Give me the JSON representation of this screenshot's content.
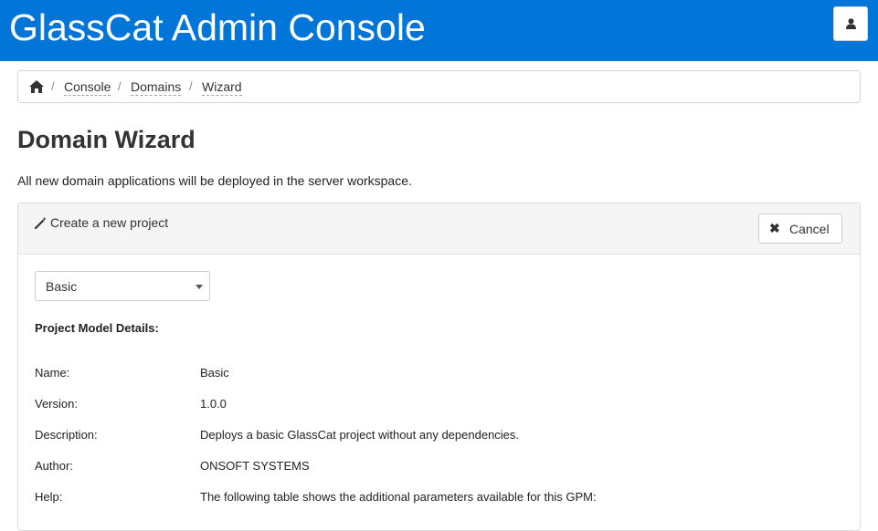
{
  "header": {
    "title": "GlassCat Admin Console",
    "user_icon": "user-icon"
  },
  "breadcrumb": {
    "home_icon": "home-icon",
    "separator": "/",
    "items": [
      "Console",
      "Domains",
      "Wizard"
    ]
  },
  "page": {
    "title": "Domain Wizard",
    "intro": "All new domain applications will be deployed in the server workspace."
  },
  "panel": {
    "title": "Create a new project",
    "title_icon": "magic-wand-icon",
    "cancel_label": "Cancel",
    "cancel_icon": "close-icon",
    "model_select": {
      "value": "Basic"
    },
    "details_heading": "Project Model Details:",
    "details": [
      {
        "label": "Name:",
        "value": "Basic"
      },
      {
        "label": "Version:",
        "value": "1.0.0"
      },
      {
        "label": "Description:",
        "value": "Deploys a basic GlassCat project without any dependencies."
      },
      {
        "label": "Author:",
        "value": "ONSOFT SYSTEMS"
      },
      {
        "label": "Help:",
        "value": "The following table shows the additional parameters available for this GPM:"
      }
    ]
  },
  "colors": {
    "header_bg": "#0275d8",
    "panel_head_bg": "#f5f5f5"
  }
}
